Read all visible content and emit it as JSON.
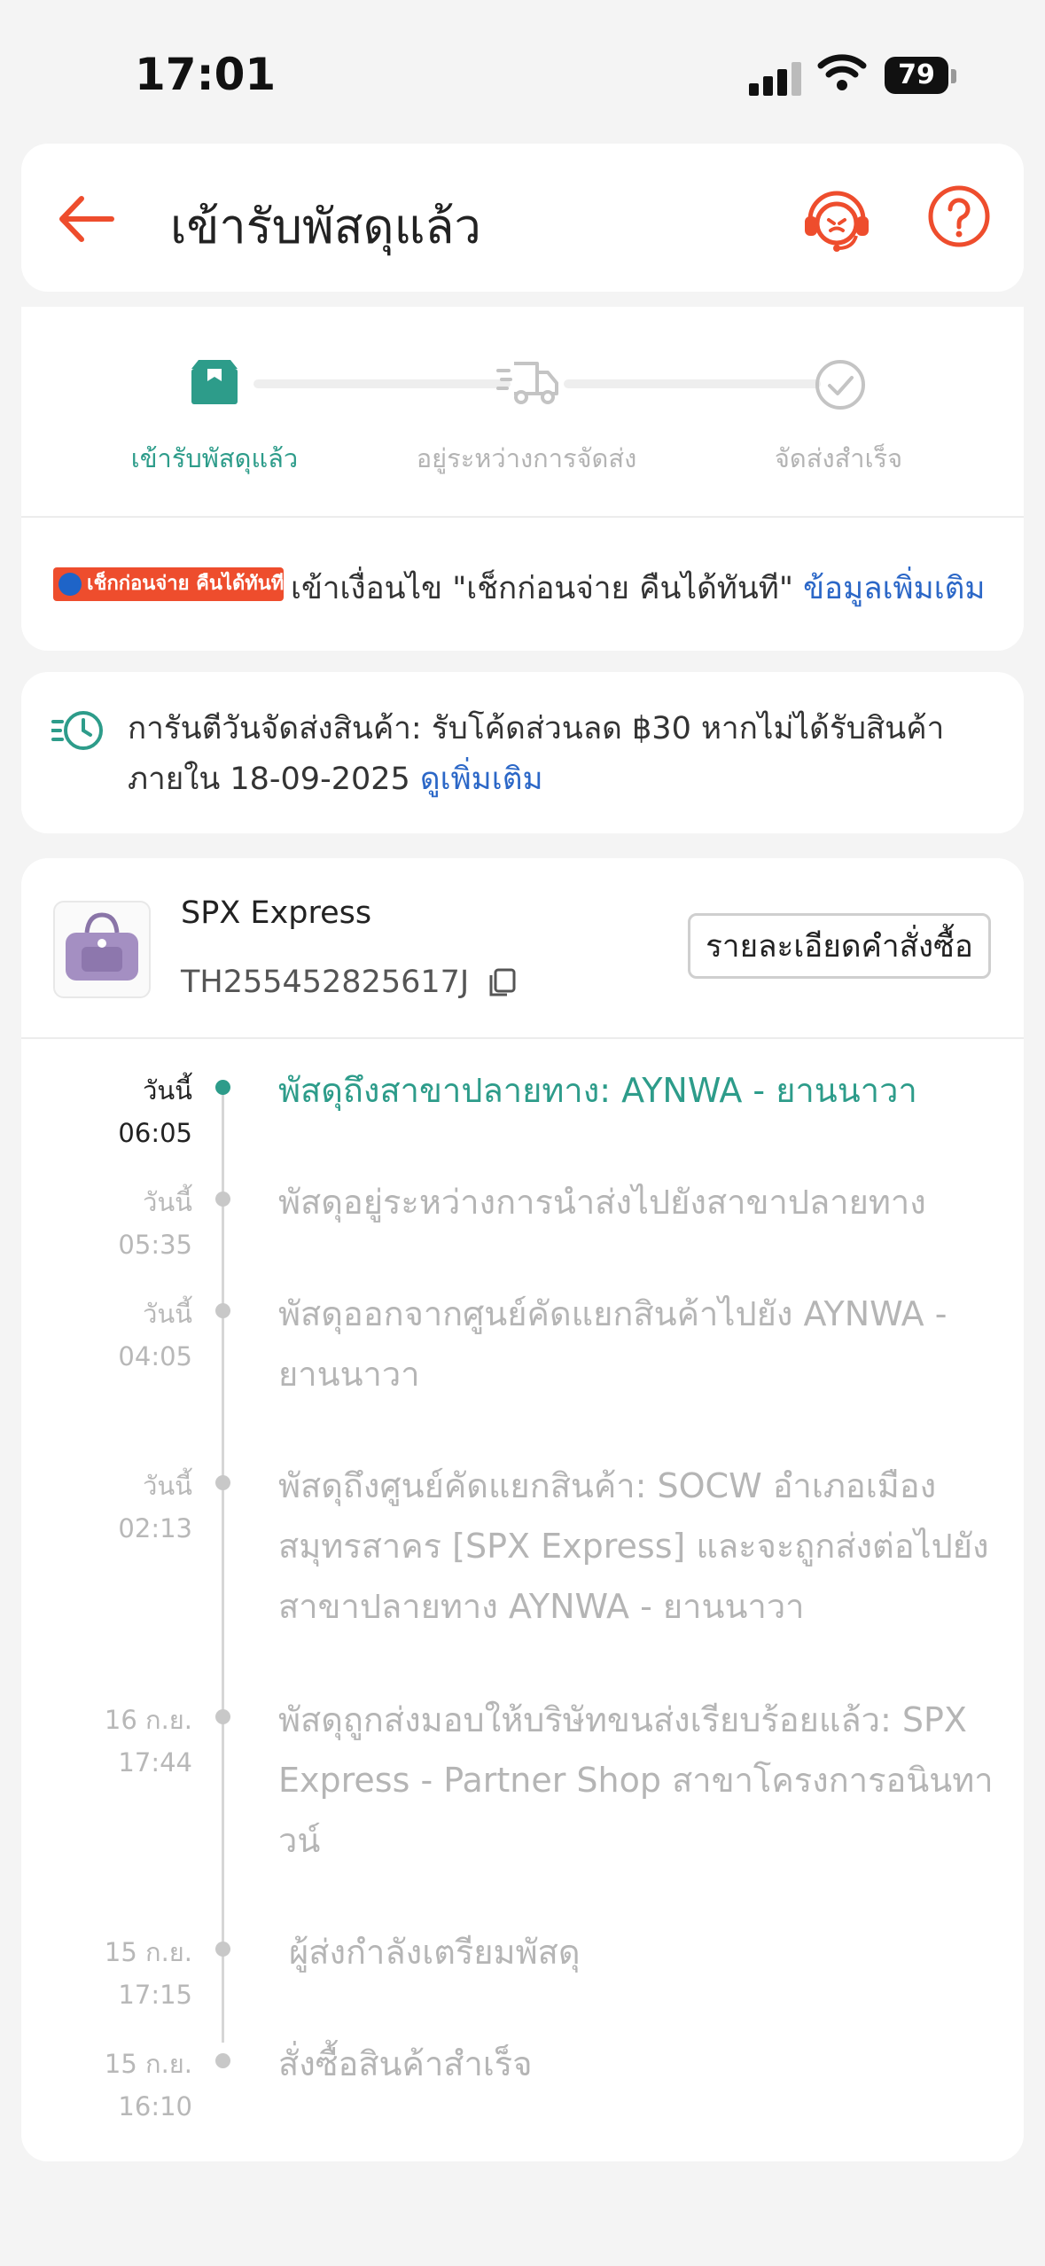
{
  "status_bar": {
    "time": "17:01",
    "battery": "79"
  },
  "header": {
    "title": "เข้ารับพัสดุแล้ว"
  },
  "progress": {
    "steps": [
      {
        "label": "เข้ารับพัสดุแล้ว"
      },
      {
        "label": "อยู่ระหว่างการจัดส่ง"
      },
      {
        "label": "จัดส่งสำเร็จ"
      }
    ],
    "active_color": "#2d9c8a",
    "inactive_color": "#b4b4b4"
  },
  "cod": {
    "badge": "เช็กก่อนจ่าย คืนได้ทันที",
    "text": "เข้าเงื่อนไข \"เช็กก่อนจ่าย คืนได้ทันที\"",
    "link": "ข้อมูลเพิ่มเติม"
  },
  "guarantee": {
    "text": "การันตีวันจัดส่งสินค้า: รับโค้ดส่วนลด ฿30 หากไม่ได้รับสินค้าภายใน 18-09-2025",
    "link": "ดูเพิ่มเติม"
  },
  "shipment": {
    "carrier": "SPX Express",
    "tracking_number": "TH255452825617J",
    "order_details_button": "รายละเอียดคำสั่งซื้อ"
  },
  "timeline": [
    {
      "day": "วันนี้",
      "time": "06:05",
      "text": "พัสดุถึงสาขาปลายทาง: AYNWA - ยานนาวา"
    },
    {
      "day": "วันนี้",
      "time": "05:35",
      "text": "พัสดุอยู่ระหว่างการนำส่งไปยังสาขาปลายทาง"
    },
    {
      "day": "วันนี้",
      "time": "04:05",
      "text": "พัสดุออกจากศูนย์คัดแยกสินค้าไปยัง AYNWA - ยานนาวา"
    },
    {
      "day": "วันนี้",
      "time": "02:13",
      "text": "พัสดุถึงศูนย์คัดแยกสินค้า: SOCW อำเภอเมืองสมุทรสาคร [SPX Express] และจะถูกส่งต่อไปยังสาขาปลายทาง AYNWA - ยานนาวา"
    },
    {
      "day": "16 ก.ย.",
      "time": "17:44",
      "text": "พัสดุถูกส่งมอบให้บริษัทขนส่งเรียบร้อยแล้ว: SPX Express - Partner Shop สาขาโครงการอนินทาวน์"
    },
    {
      "day": "15 ก.ย.",
      "time": "17:15",
      "text": "ผู้ส่งกำลังเตรียมพัสดุ"
    },
    {
      "day": "15 ก.ย.",
      "time": "16:10",
      "text": "สั่งซื้อสินค้าสำเร็จ"
    }
  ],
  "colors": {
    "accent": "#ee4d2d",
    "teal": "#2d9c8a",
    "link": "#2b67c7"
  }
}
